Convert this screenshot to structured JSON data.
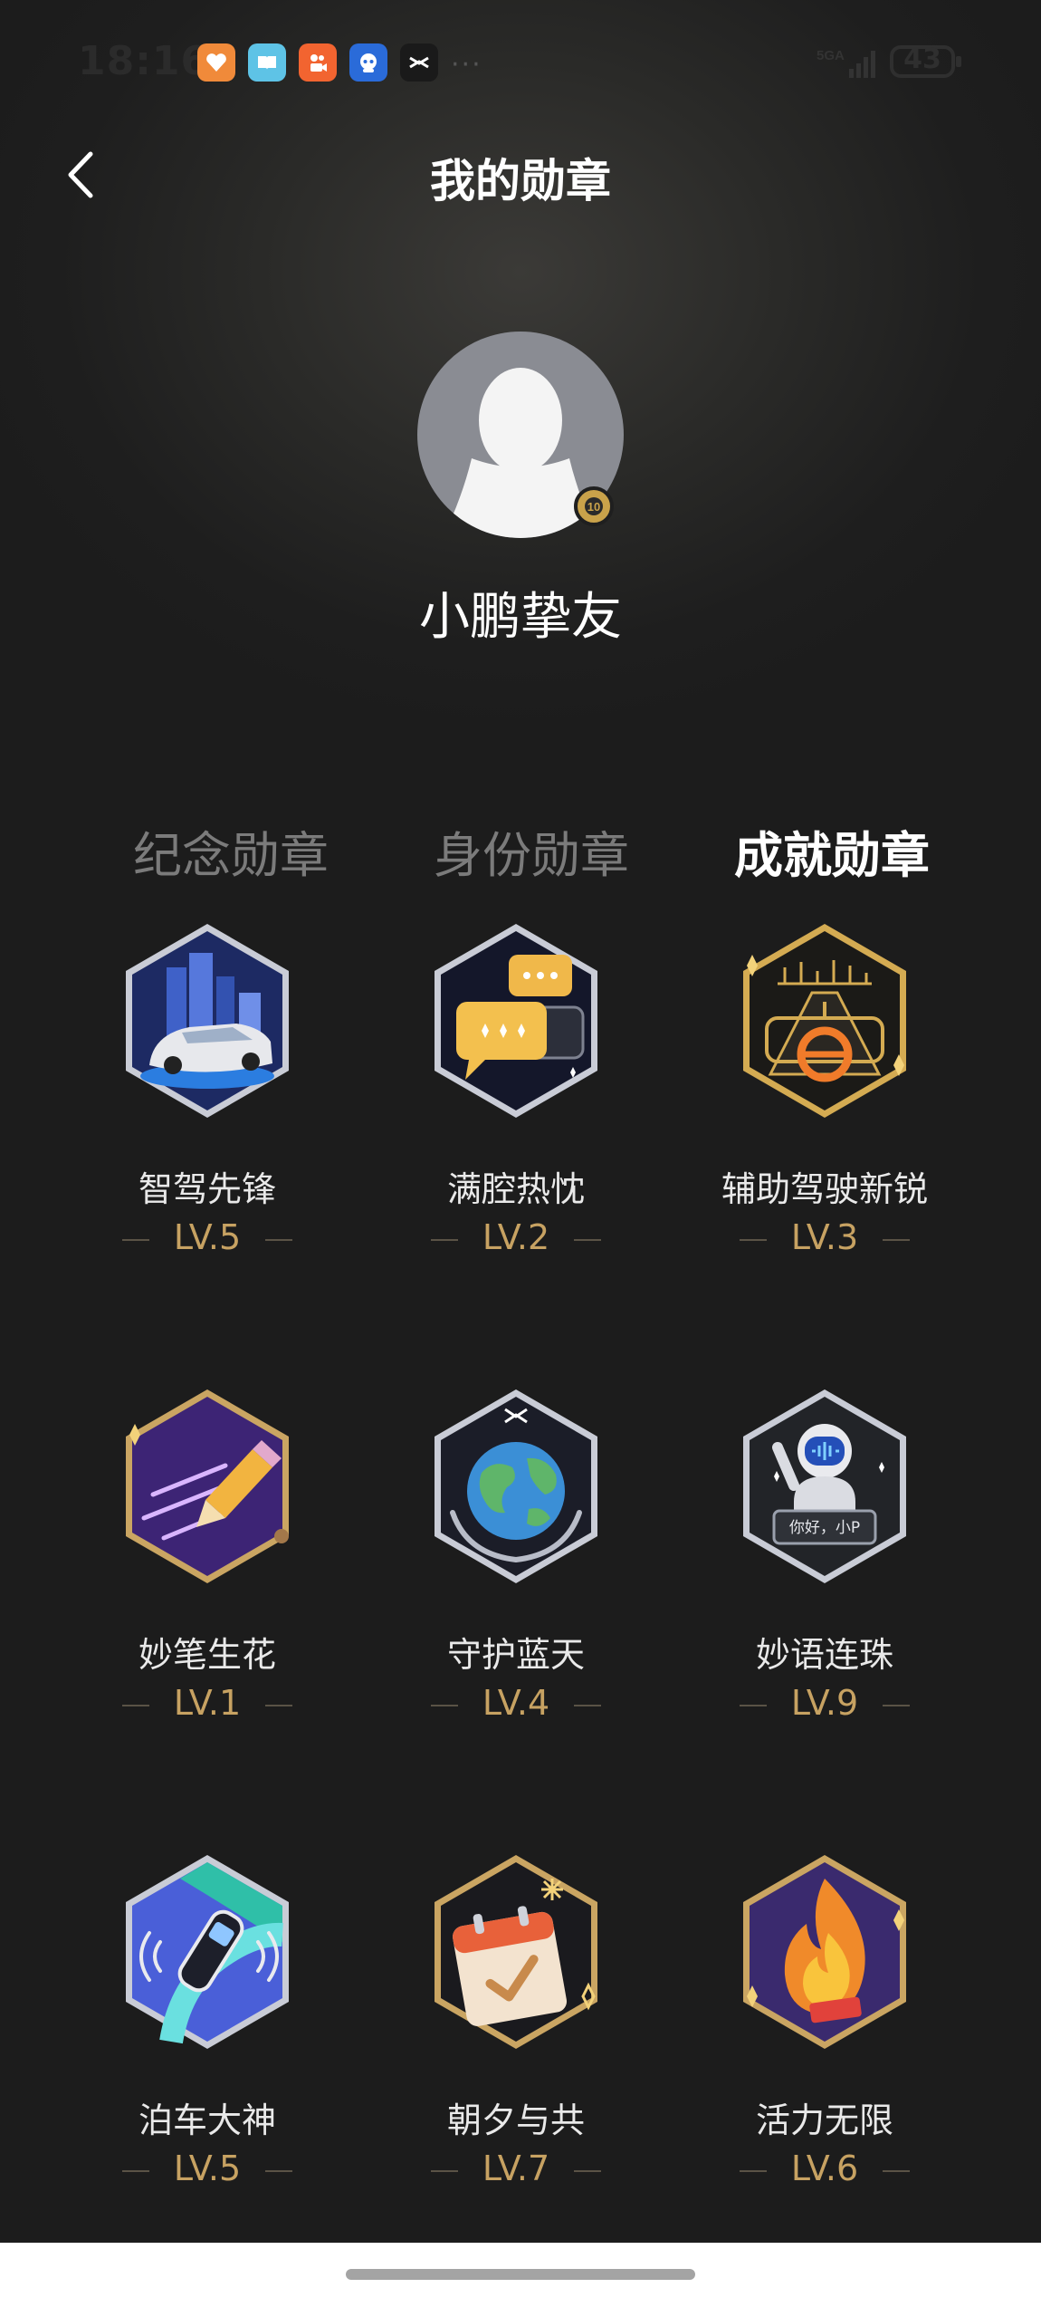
{
  "status_bar": {
    "time": "18:16",
    "network": "5GA",
    "battery": "43",
    "more": "···",
    "app_icons": [
      "health-heart-icon",
      "reader-book-icon",
      "kuaishou-icon",
      "bot-app-icon",
      "xpeng-icon"
    ]
  },
  "header": {
    "title": "我的勋章",
    "back_icon": "chevron-left-icon"
  },
  "profile": {
    "username": "小鹏挚友"
  },
  "tabs": [
    {
      "label": "纪念勋章",
      "active": false
    },
    {
      "label": "身份勋章",
      "active": false
    },
    {
      "label": "成就勋章",
      "active": true
    }
  ],
  "medals": [
    {
      "name": "智驾先锋",
      "level": "LV.5",
      "icon": "smart-driving-car-icon"
    },
    {
      "name": "满腔热忱",
      "level": "LV.2",
      "icon": "chat-bubbles-icon"
    },
    {
      "name": "辅助驾驶新锐",
      "level": "LV.3",
      "icon": "driving-assist-road-icon"
    },
    {
      "name": "妙笔生花",
      "level": "LV.1",
      "icon": "pencil-icon"
    },
    {
      "name": "守护蓝天",
      "level": "LV.4",
      "icon": "earth-hands-icon"
    },
    {
      "name": "妙语连珠",
      "level": "LV.9",
      "icon": "robot-voice-icon",
      "speech_text": "你好，小P"
    },
    {
      "name": "泊车大神",
      "level": "LV.5",
      "icon": "parking-car-icon"
    },
    {
      "name": "朝夕与共",
      "level": "LV.7",
      "icon": "calendar-check-icon"
    },
    {
      "name": "活力无限",
      "level": "LV.6",
      "icon": "flame-icon"
    }
  ],
  "colors": {
    "background": "#1d1d1d",
    "level_gold": "#c7a262",
    "tab_inactive": "#7b7b7b",
    "tab_active": "#ffffff"
  }
}
